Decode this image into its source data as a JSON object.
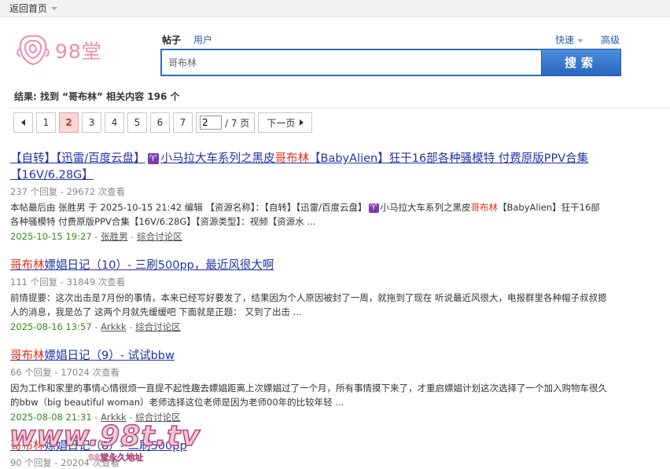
{
  "topbar": {
    "back_label": "返回首页"
  },
  "logo": {
    "text": "98堂"
  },
  "search": {
    "tab_active": "帖子",
    "tab_inactive": "用户",
    "quick_label": "快速",
    "advanced_label": "高级",
    "query": "哥布林",
    "button_label": "搜索"
  },
  "results_summary": "结果: 找到 “哥布林” 相关内容 196 个",
  "pager": {
    "pages": [
      "1",
      "2",
      "3",
      "4",
      "5",
      "6",
      "7"
    ],
    "current": "2",
    "jump_value": "2",
    "total_label": "/ 7 页",
    "next_label": "下一页"
  },
  "results": [
    {
      "title_pre": "【自转】【迅雷/百度云盘】",
      "title_badge": "♈",
      "title_mid": "小马拉大车系列之黑皮",
      "title_hl": "哥布林",
      "title_post": "【BabyAlien】狂干16部各种骚模特 付费原版PPV合集【16V/6.28G】",
      "meta": "237 个回复 - 29672 次查看",
      "desc_pre": "本帖最后由 张胜男 于 2025-10-15 21:42 编辑 【资源名称】：【自转】【迅雷/百度云盘】",
      "desc_badge": "♈",
      "desc_mid": "小马拉大车系列之黑皮",
      "desc_hl": "哥布林",
      "desc_post": "【BabyAlien】狂干16部各种骚模特 付费原版PPV合集【16V/6.28G】【资源类型】：视频【资源水 ...",
      "date": "2025-10-15 19:27",
      "author": "张胜男",
      "forum": "综合讨论区"
    },
    {
      "title_hl": "哥布林",
      "title_post": "嫖娼日记（10）- 三刷500pp，最近风很大啊",
      "meta": "111 个回复 - 31849 次查看",
      "desc": "前情提要：这次出击是7月份的事情，本来已经写好要发了，结果因为个人原因被封了一周，就拖到了现在 听说最近风很大，电报群里各种帽子叔叔摁人的消息，我是怂了 这两个月就先缓缓吧 下面就是正题： 又到了出击 ...",
      "date": "2025-08-16 13:57",
      "author": "Arkkk",
      "forum": "综合讨论区"
    },
    {
      "title_hl": "哥布林",
      "title_post": "嫖娼日记（9）- 试试bbw",
      "meta": "66 个回复 - 17024 次查看",
      "desc": "因为工作和家里的事情心情很烦一直提不起性趣去嫖娼距离上次嫖娼过了一个月，所有事情摸下来了，才重启嫖娼计划这次选择了一个加入购物车很久的bbw（big beautiful woman）老师选择这位老师是因为老师00年的比较年轻 ...",
      "date": "2025-08-08 21:31",
      "author": "Arkkk",
      "forum": "综合讨论区"
    },
    {
      "title_hl": "哥布林",
      "title_post": "嫖娼日记（8）- 二刷500pp",
      "meta": "90 个回复 - 20204 次查看"
    }
  ],
  "watermark": {
    "main": "www.98t.tv",
    "sub": "98堂永久地址"
  },
  "colors": {
    "brand_pink": "#f08cb0",
    "link_blue": "#2233aa",
    "highlight_red": "#e0301e",
    "date_green": "#3a8a1e",
    "button_blue": "#2a66bb"
  }
}
